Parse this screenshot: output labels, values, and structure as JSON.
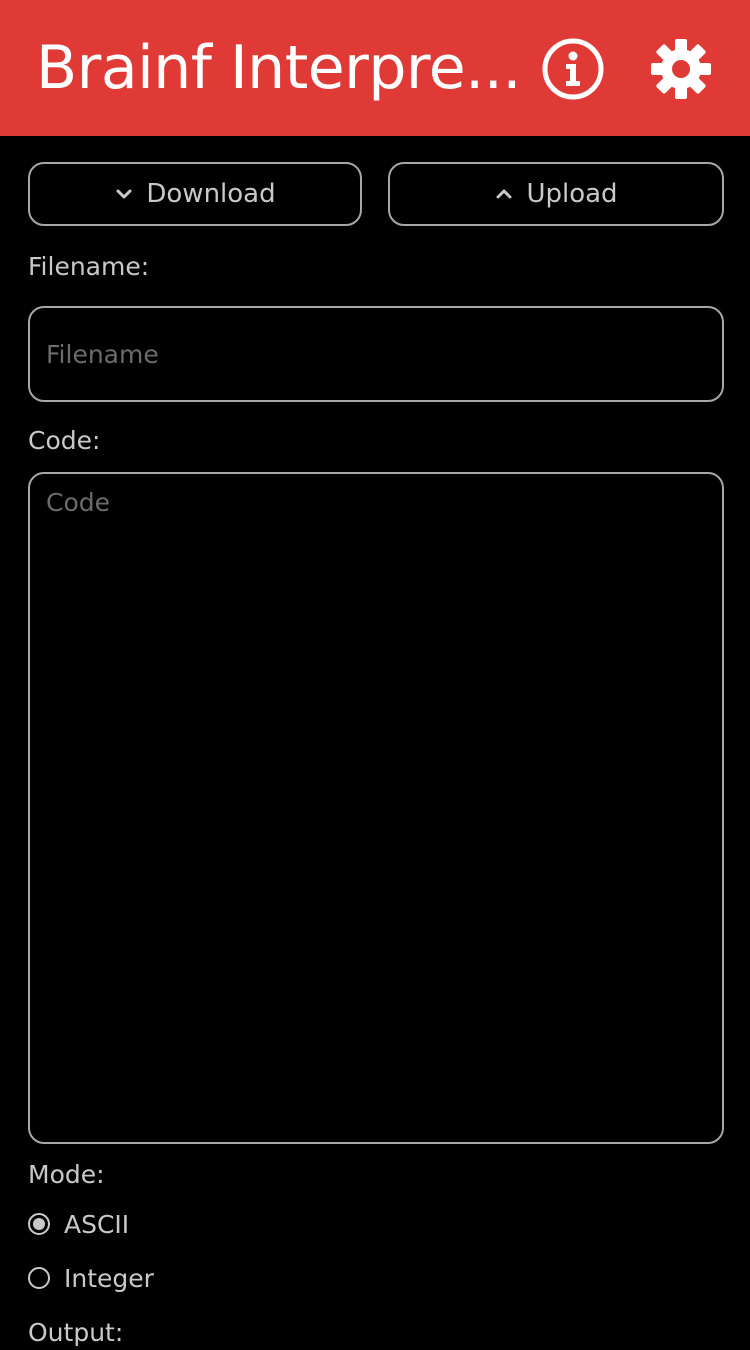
{
  "header": {
    "title": "Brainf Interpre...",
    "info_icon": "info-icon",
    "settings_icon": "gear-icon",
    "background_color": "#e03a36"
  },
  "toolbar": {
    "download_label": "Download",
    "upload_label": "Upload"
  },
  "form": {
    "filename_label": "Filename:",
    "filename_placeholder": "Filename",
    "filename_value": "",
    "code_label": "Code:",
    "code_placeholder": "Code",
    "code_value": "",
    "mode_label": "Mode:",
    "mode_options": [
      {
        "label": "ASCII",
        "selected": true
      },
      {
        "label": "Integer",
        "selected": false
      }
    ],
    "output_label": "Output:"
  }
}
